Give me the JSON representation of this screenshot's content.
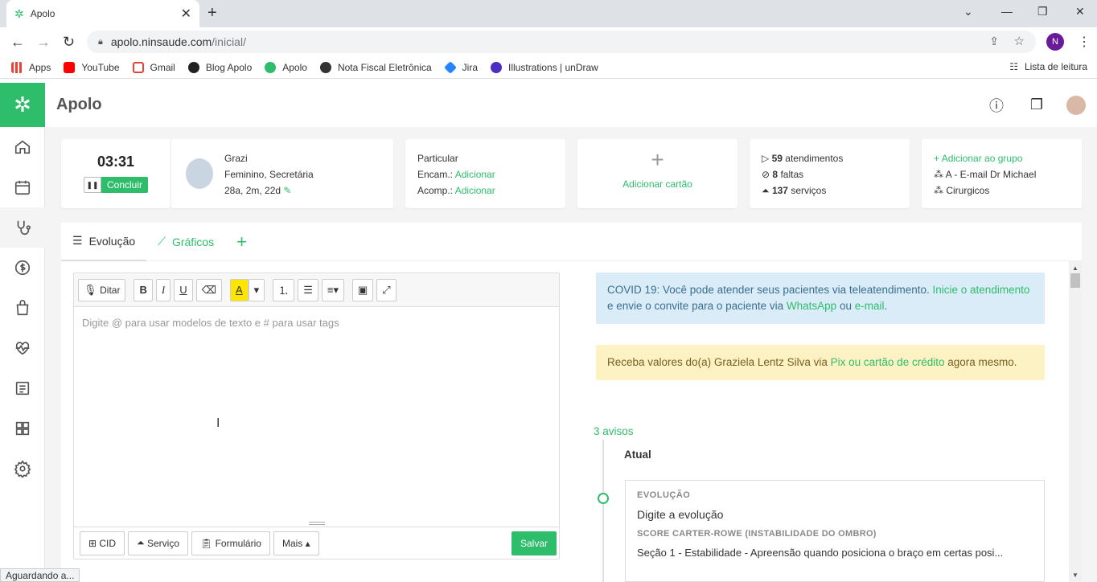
{
  "browser": {
    "tab_title": "Apolo",
    "url_host": "apolo.ninsaude.com",
    "url_path": "/inicial/",
    "profile_initial": "N",
    "bookmarks": [
      "Apps",
      "YouTube",
      "Gmail",
      "Blog Apolo",
      "Apolo",
      "Nota Fiscal Eletrônica",
      "Jira",
      "Illustrations | unDraw"
    ],
    "reading_list": "Lista de leitura",
    "status": "Aguardando a..."
  },
  "app": {
    "brand": "Apolo",
    "accent": "#2ebd6b"
  },
  "timer": {
    "value": "03:31",
    "conclude_label": "Concluir"
  },
  "patient": {
    "name": "Grazi",
    "details": "Feminino, Secretária",
    "age": "28a, 2m, 22d"
  },
  "plan": {
    "type": "Particular",
    "encam_label": "Encam.:",
    "encam_link": "Adicionar",
    "acomp_label": "Acomp.:",
    "acomp_link": "Adicionar"
  },
  "card_add": {
    "plus": "+",
    "label": "Adicionar cartão"
  },
  "stats": {
    "attend_count": "59",
    "attend_label": "atendimentos",
    "miss_count": "8",
    "miss_label": "faltas",
    "serv_count": "137",
    "serv_label": "serviços"
  },
  "groups": {
    "add_label": "Adicionar ao grupo",
    "items": [
      "A - E-mail Dr Michael",
      "Cirurgicos"
    ]
  },
  "tabs": {
    "evolucao": "Evolução",
    "graficos": "Gráficos"
  },
  "editor": {
    "ditar": "Ditar",
    "placeholder": "Digite @ para usar modelos de texto e # para usar tags",
    "footer": {
      "cid": "CID",
      "servico": "Serviço",
      "formulario": "Formulário",
      "mais": "Mais",
      "salvar": "Salvar"
    }
  },
  "covid": {
    "t1": "COVID 19: Você pode atender seus pacientes via teleatendimento. ",
    "l1": "Inicie o atendimento",
    "t2": " e envie o convite para o paciente via ",
    "l2": "WhatsApp",
    "t3": " ou ",
    "l3": "e-mail",
    "t4": "."
  },
  "pix": {
    "t1": "Receba valores do(a) Graziela Lentz Silva via ",
    "l1": "Pix ou cartão de crédito",
    "t2": " agora mesmo."
  },
  "timeline": {
    "avisos": "3 avisos",
    "atual": "Atual",
    "evo_label": "EVOLUÇÃO",
    "evo_text": "Digite a evolução",
    "score_label": "SCORE CARTER-ROWE (INSTABILIDADE DO OMBRO)",
    "score_text": "Seção 1 - Estabilidade - Apreensão quando posiciona o braço em certas posi..."
  }
}
